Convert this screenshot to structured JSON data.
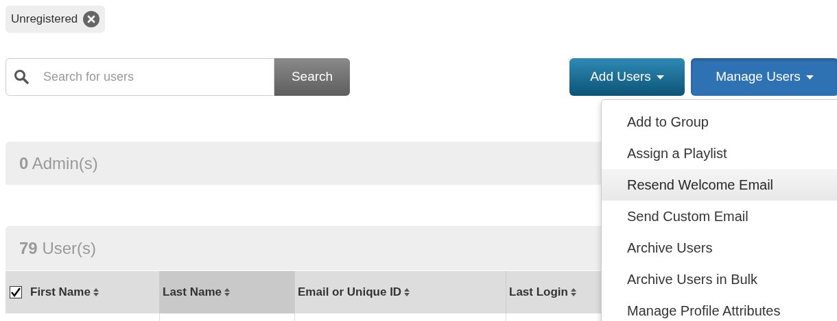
{
  "filter_chip": {
    "label": "Unregistered"
  },
  "search": {
    "placeholder": "Search for users",
    "button": "Search"
  },
  "actions": [
    {
      "label": "Add Users",
      "kind": "dark",
      "expanded": false
    },
    {
      "label": "Manage Users",
      "kind": "primary",
      "expanded": true
    }
  ],
  "menu": [
    {
      "label": "Add to Group",
      "selected": false
    },
    {
      "label": "Assign a Playlist",
      "selected": false
    },
    {
      "label": "Resend Welcome Email",
      "selected": true
    },
    {
      "label": "Send Custom Email",
      "selected": false
    },
    {
      "label": "Archive Users",
      "selected": false
    },
    {
      "label": "Archive Users in Bulk",
      "selected": false
    },
    {
      "label": "Manage Profile Attributes",
      "selected": false
    }
  ],
  "admins": {
    "count": "0",
    "label": "Admin(s)"
  },
  "users": {
    "count": "79",
    "label": "User(s)"
  },
  "table": {
    "select_all": {
      "checked": true
    },
    "columns": [
      {
        "label": "First Name",
        "sorted": false
      },
      {
        "label": "Last Name",
        "sorted": true
      },
      {
        "label": "Email or Unique ID",
        "sorted": false
      },
      {
        "label": "Last Login",
        "sorted": false
      }
    ]
  }
}
